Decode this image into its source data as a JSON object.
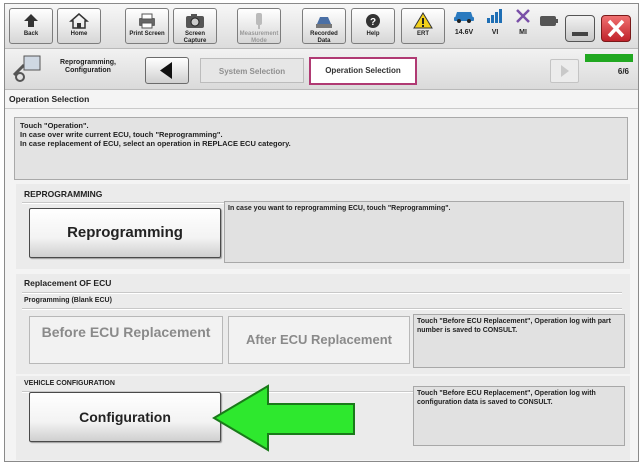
{
  "toolbar": {
    "back": "Back",
    "home": "Home",
    "print_screen": "Print Screen",
    "screen_capture": "Screen Capture",
    "measurement_mode": "Measurement Mode",
    "recorded_data": "Recorded Data",
    "help": "Help",
    "ert": "ERT",
    "voltage": "14.6V",
    "vi": "VI",
    "mi": "MI"
  },
  "breadcrumb": {
    "reprogramming_configuration": "Reprogramming, Configuration",
    "system_selection": "System Selection",
    "operation_selection": "Operation Selection",
    "page": "6/6",
    "progress_fraction": 1.0
  },
  "page_title": "Operation Selection",
  "info": {
    "line1": "Touch \"Operation\".",
    "line2": "In case over write current ECU, touch \"Reprogramming\".",
    "line3": "In case replacement of ECU, select an operation in REPLACE ECU category."
  },
  "reprogramming": {
    "title": "REPROGRAMMING",
    "button": "Reprogramming",
    "description": "In case you want to reprogramming ECU, touch \"Reprogramming\"."
  },
  "replacement": {
    "title": "Replacement OF ECU",
    "subtitle": "Programming (Blank ECU)",
    "before_button": "Before ECU Replacement",
    "after_button": "After ECU Replacement",
    "description": "Touch \"Before ECU Replacement\", Operation log with part number is saved to CONSULT."
  },
  "vehicle_configuration": {
    "title": "VEHICLE CONFIGURATION",
    "button": "Configuration",
    "description": "Touch \"Before ECU Replacement\", Operation log with configuration data is saved to CONSULT."
  },
  "colors": {
    "accent_pink": "#b03a73",
    "progress_green": "#21a821",
    "annotation_arrow": "#2ee82e"
  }
}
